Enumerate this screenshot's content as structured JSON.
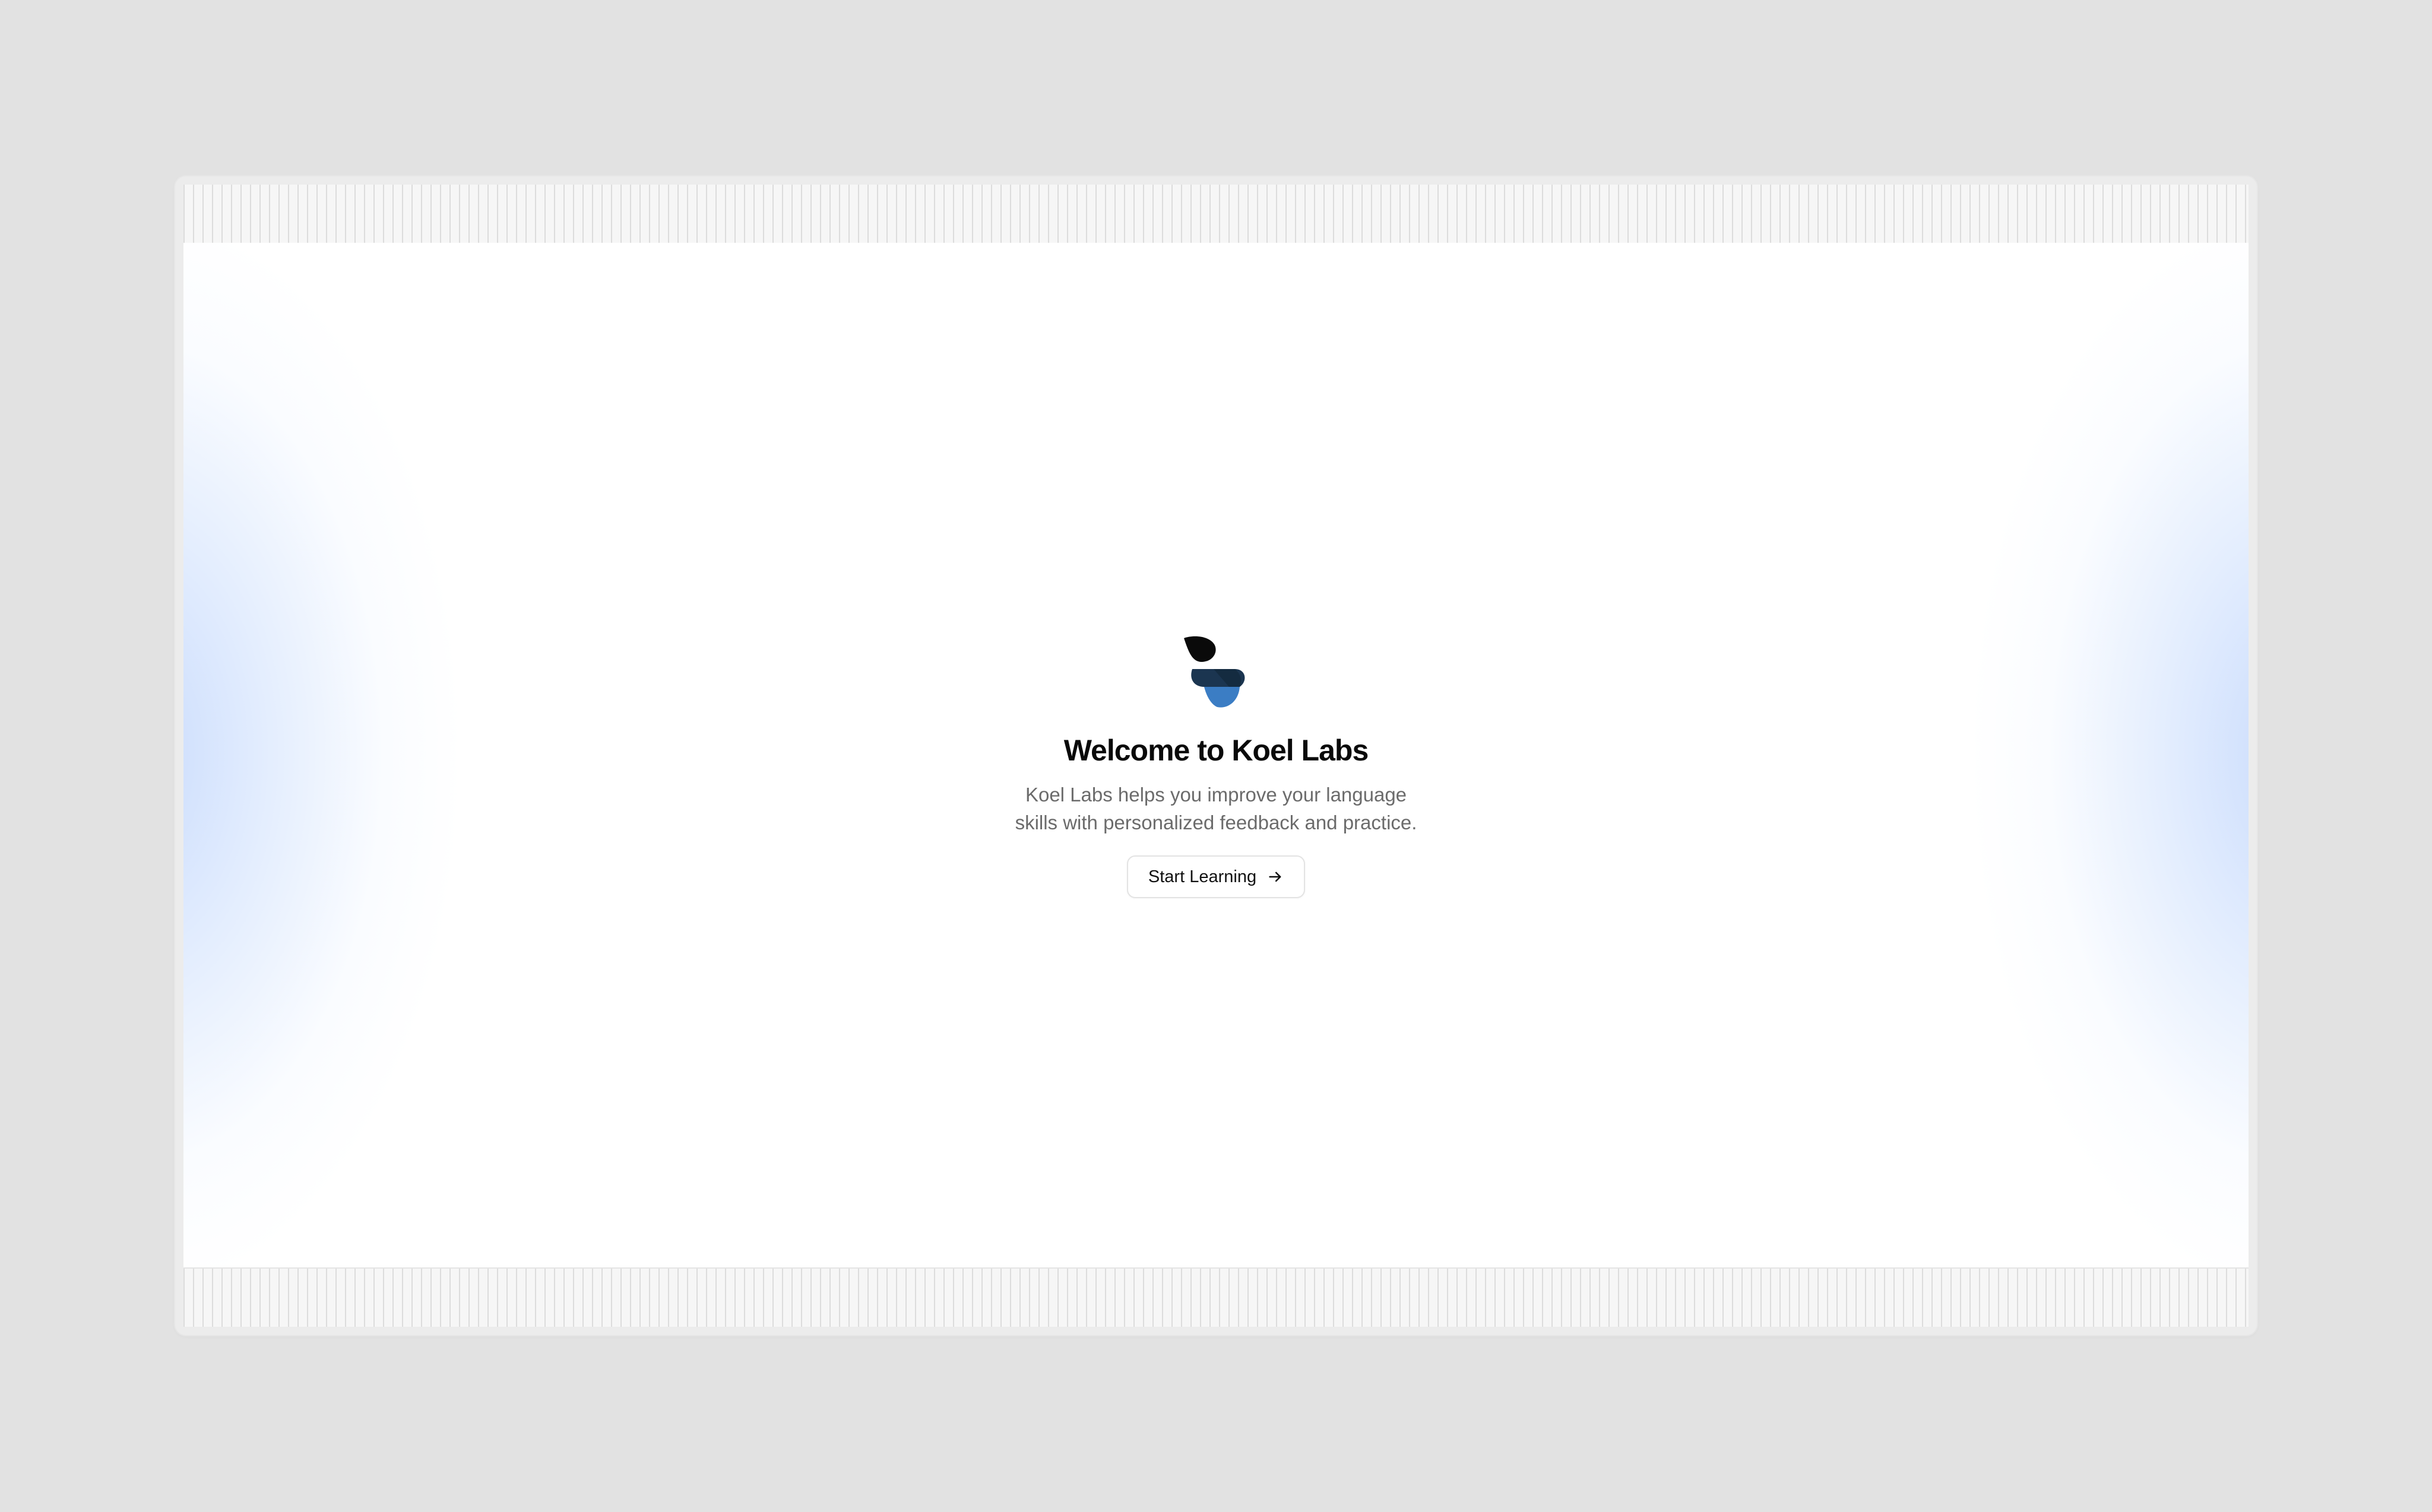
{
  "hero": {
    "title": "Welcome to Koel Labs",
    "subtitle": "Koel Labs helps you improve your language skills with personalized feedback and practice.",
    "cta_label": "Start Learning",
    "cta_icon": "arrow-right-icon",
    "logo_icon": "koel-labs-logo"
  },
  "colors": {
    "page_background": "#e2e2e2",
    "canvas_background": "#ffffff",
    "glow": "#cfe0fd",
    "logo_black": "#0a0a0a",
    "logo_navy": "#1b3550",
    "logo_blue": "#3b7dc4",
    "title_text": "#0a0a0a",
    "subtitle_text": "#6b6b6b"
  }
}
